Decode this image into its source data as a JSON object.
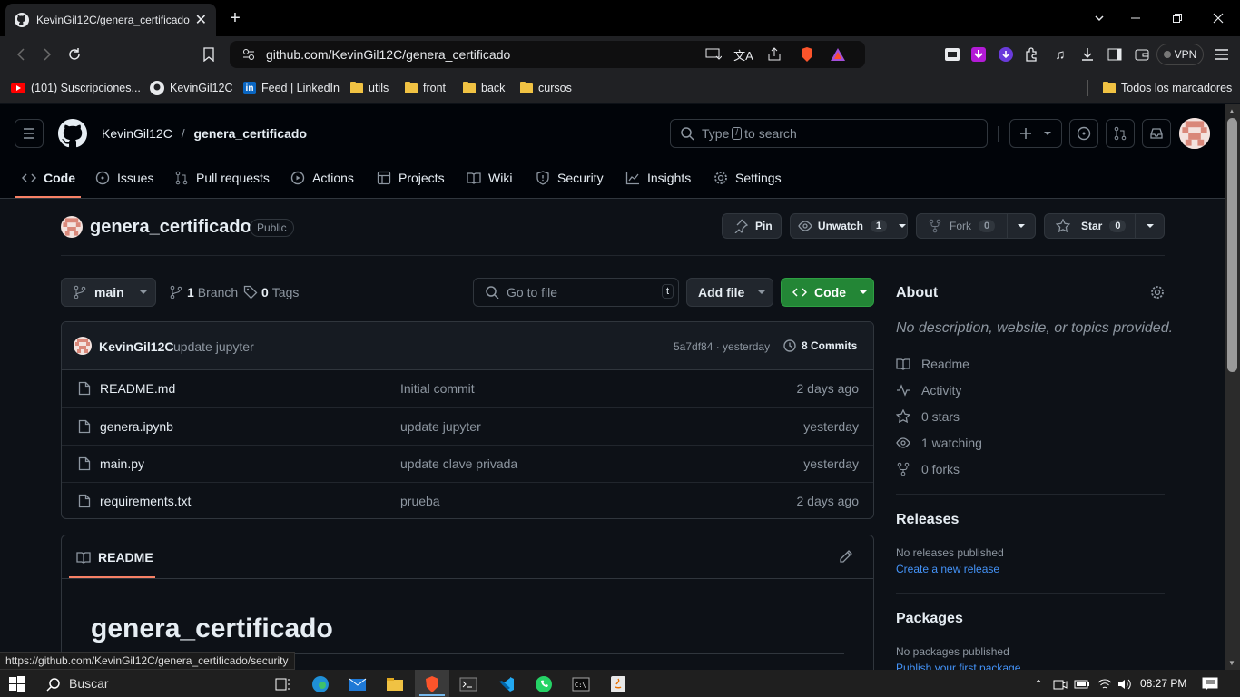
{
  "browser": {
    "tab_title": "KevinGil12C/genera_certificado",
    "url": "github.com/KevinGil12C/genera_certificado",
    "vpn_label": "VPN",
    "status_url": "https://github.com/KevinGil12C/genera_certificado/security"
  },
  "bookmarks": [
    {
      "label": "(101) Suscripciones..."
    },
    {
      "label": "KevinGil12C"
    },
    {
      "label": "Feed | LinkedIn"
    },
    {
      "label": "utils"
    },
    {
      "label": "front"
    },
    {
      "label": "back"
    },
    {
      "label": "cursos"
    }
  ],
  "bookmarks_all": "Todos los marcadores",
  "github": {
    "owner": "KevinGil12C",
    "separator": "/",
    "repo": "genera_certificado",
    "search_prefix": "Type",
    "search_key": "/",
    "search_suffix": "to search",
    "nav": [
      "Code",
      "Issues",
      "Pull requests",
      "Actions",
      "Projects",
      "Wiki",
      "Security",
      "Insights",
      "Settings"
    ]
  },
  "repo": {
    "name": "genera_certificado",
    "visibility": "Public",
    "pin": "Pin",
    "unwatch": "Unwatch",
    "watch_count": "1",
    "fork": "Fork",
    "fork_count": "0",
    "star": "Star",
    "star_count": "0",
    "branch": "main",
    "branches_count": "1",
    "branches_label": "Branch",
    "tags_count": "0",
    "tags_label": "Tags",
    "go_to_file": "Go to file",
    "go_to_file_key": "t",
    "add_file": "Add file",
    "code_button": "Code"
  },
  "commit": {
    "author": "KevinGil12C",
    "message": "update jupyter",
    "hash_time": "5a7df84 · yesterday",
    "commits": "8 Commits"
  },
  "files": [
    {
      "name": "README.md",
      "message": "Initial commit",
      "date": "2 days ago"
    },
    {
      "name": "genera.ipynb",
      "message": "update jupyter",
      "date": "yesterday"
    },
    {
      "name": "main.py",
      "message": "update clave privada",
      "date": "yesterday"
    },
    {
      "name": "requirements.txt",
      "message": "prueba",
      "date": "2 days ago"
    }
  ],
  "readme": {
    "tab": "README",
    "heading": "genera_certificado"
  },
  "about": {
    "title": "About",
    "description": "No description, website, or topics provided.",
    "items": [
      "Readme",
      "Activity",
      "0 stars",
      "1 watching",
      "0 forks"
    ]
  },
  "releases": {
    "title": "Releases",
    "none": "No releases published",
    "link": "Create a new release"
  },
  "packages": {
    "title": "Packages",
    "none": "No packages published",
    "link": "Publish your first package"
  },
  "taskbar": {
    "search": "Buscar",
    "time": "08:27 PM"
  },
  "colors": {
    "accent": "#f78166",
    "code_green": "#238636",
    "link": "#4493f8"
  }
}
